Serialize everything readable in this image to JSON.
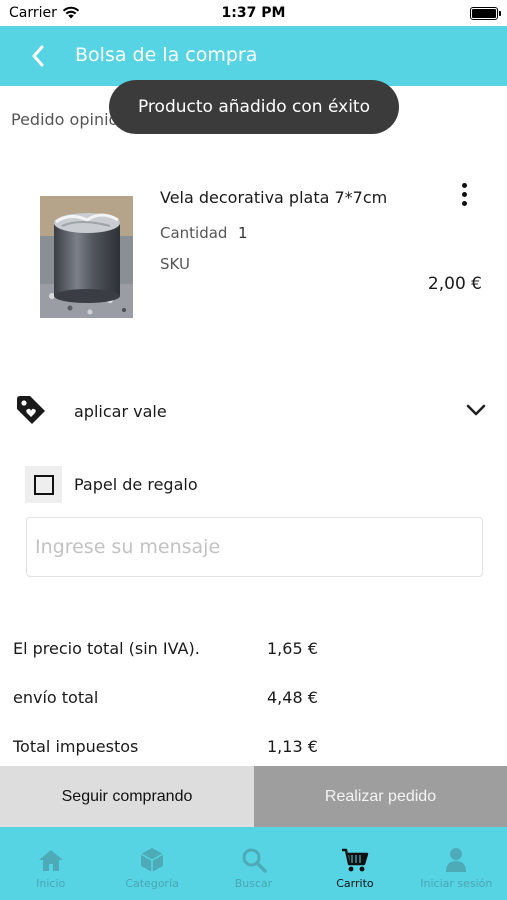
{
  "status_bar": {
    "carrier": "Carrier",
    "time": "1:37 PM"
  },
  "header": {
    "title": "Bolsa de la compra",
    "back_icon": "chevron-left-icon"
  },
  "toast": {
    "message": "Producto añadido con éxito"
  },
  "order_opinion": "Pedido opinión",
  "product": {
    "name": "Vela decorativa plata 7*7cm",
    "quantity_label": "Cantidad",
    "quantity_value": "1",
    "sku_label": "SKU",
    "price": "2,00 €",
    "more_icon": "more-vertical-icon"
  },
  "voucher": {
    "label": "aplicar vale",
    "icon": "tag-icon",
    "expand_icon": "chevron-down-icon"
  },
  "gift": {
    "label": "Papel de regalo",
    "checked": false
  },
  "message_field": {
    "placeholder": "Ingrese su mensaje",
    "value": ""
  },
  "totals": [
    {
      "label": "El precio total (sin IVA).",
      "value": "1,65 €"
    },
    {
      "label": "envío total",
      "value": "4,48 €"
    },
    {
      "label": "Total impuestos",
      "value": "1,13 €"
    }
  ],
  "actions": {
    "continue_label": "Seguir comprando",
    "order_label": "Realizar pedido"
  },
  "tab_bar": {
    "active": "Carrito",
    "tabs": [
      {
        "label": "Inicio",
        "icon": "home-icon"
      },
      {
        "label": "Categoría",
        "icon": "category-icon"
      },
      {
        "label": "Buscar",
        "icon": "search-icon"
      },
      {
        "label": "Carrito",
        "icon": "cart-icon"
      },
      {
        "label": "Iniciar sesión",
        "icon": "user-icon"
      }
    ]
  },
  "colors": {
    "primary": "#57d4e4",
    "toast_bg": "#3b3b3b",
    "continue_bg": "#dddddd",
    "order_bg": "#9e9e9e"
  }
}
